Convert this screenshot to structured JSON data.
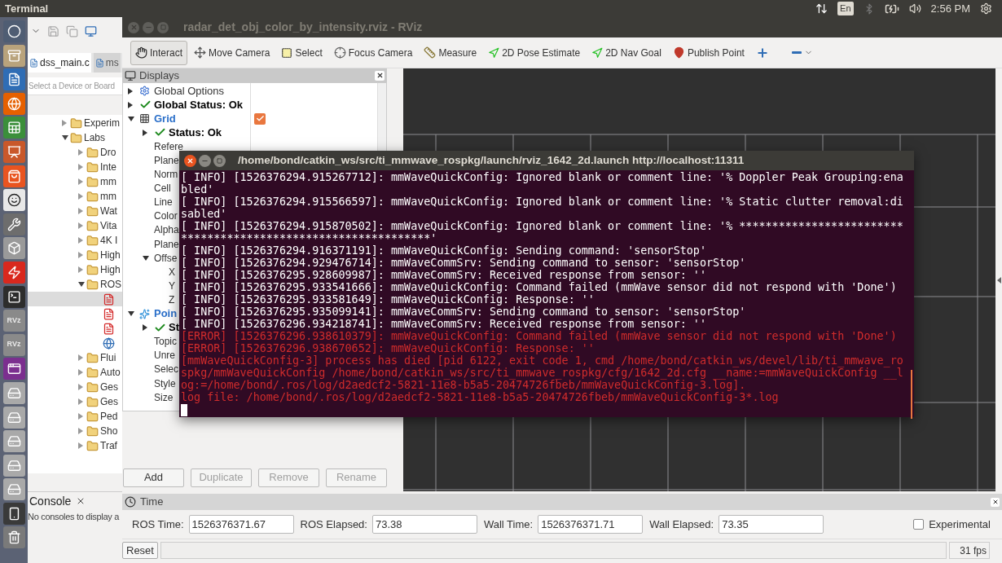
{
  "top_bar": {
    "title": "Terminal",
    "keyboard": "En",
    "clock": "2:56 PM"
  },
  "launcher": [
    {
      "kind": "home"
    },
    {
      "kind": "files"
    },
    {
      "kind": "writer"
    },
    {
      "kind": "browser"
    },
    {
      "kind": "calc"
    },
    {
      "kind": "impress"
    },
    {
      "kind": "store"
    },
    {
      "kind": "shop"
    },
    {
      "kind": "settings"
    },
    {
      "kind": "cube"
    },
    {
      "kind": "flash"
    },
    {
      "kind": "terminal"
    },
    {
      "kind": "text",
      "label": "RVz"
    },
    {
      "kind": "text",
      "label": "RVz"
    },
    {
      "kind": "window"
    },
    {
      "kind": "drive"
    },
    {
      "kind": "drive"
    },
    {
      "kind": "drive"
    },
    {
      "kind": "drive"
    },
    {
      "kind": "drive"
    },
    {
      "kind": "phone"
    },
    {
      "kind": "trash"
    }
  ],
  "ide": {
    "tabs": [
      {
        "label": "dss_main.c",
        "selected": true
      },
      {
        "label": "ms",
        "selected": false
      }
    ],
    "search": {
      "placeholder": "Select a Device or Board"
    },
    "tree": [
      {
        "label": "Experim",
        "kind": "folder",
        "expanded": false,
        "selected": false
      },
      {
        "label": "Labs",
        "kind": "folder",
        "expanded": true,
        "selected": false,
        "children": [
          {
            "label": "Dro",
            "kind": "folder",
            "expanded": false,
            "selected": false
          },
          {
            "label": "Inte",
            "kind": "folder",
            "expanded": false,
            "selected": false
          },
          {
            "label": "mm",
            "kind": "folder",
            "expanded": false,
            "selected": false
          },
          {
            "label": "mm",
            "kind": "folder",
            "expanded": false,
            "selected": false
          },
          {
            "label": "Wat",
            "kind": "folder",
            "expanded": false,
            "selected": false
          },
          {
            "label": "Vita",
            "kind": "folder",
            "expanded": false,
            "selected": false
          },
          {
            "label": "4K I",
            "kind": "folder",
            "expanded": false,
            "selected": false
          },
          {
            "label": "High",
            "kind": "folder",
            "expanded": false,
            "selected": false
          },
          {
            "label": "High",
            "kind": "folder",
            "expanded": false,
            "selected": false
          },
          {
            "label": "ROS",
            "kind": "folder",
            "expanded": true,
            "selected": false,
            "children": [
              {
                "kind": "pdf",
                "selected": true
              },
              {
                "kind": "pdf",
                "selected": false
              },
              {
                "kind": "pdf",
                "selected": false
              },
              {
                "kind": "web",
                "selected": false
              }
            ]
          },
          {
            "label": "Flui",
            "kind": "folder",
            "expanded": false,
            "selected": false
          },
          {
            "label": "Auto",
            "kind": "folder",
            "expanded": false,
            "selected": false
          },
          {
            "label": "Ges",
            "kind": "folder",
            "expanded": false,
            "selected": false
          },
          {
            "label": "Ges",
            "kind": "folder",
            "expanded": false,
            "selected": false
          },
          {
            "label": "Ped",
            "kind": "folder",
            "expanded": false,
            "selected": false
          },
          {
            "label": "Sho",
            "kind": "folder",
            "expanded": false,
            "selected": false
          },
          {
            "label": "Traf",
            "kind": "folder",
            "expanded": false,
            "selected": false
          }
        ]
      }
    ],
    "console": {
      "tab": "Console",
      "message": "No consoles to display a"
    }
  },
  "rviz": {
    "title": "radar_det_obj_color_by_intensity.rviz - RViz",
    "tools": [
      {
        "kind": "interact",
        "label": "Interact",
        "selected": true
      },
      {
        "kind": "move-camera",
        "label": "Move Camera",
        "selected": false
      },
      {
        "kind": "select",
        "label": "Select",
        "selected": false
      },
      {
        "kind": "focus-camera",
        "label": "Focus Camera",
        "selected": false
      },
      {
        "kind": "measure",
        "label": "Measure",
        "selected": false
      },
      {
        "kind": "pose",
        "label": "2D Pose Estimate",
        "selected": false
      },
      {
        "kind": "nav-goal",
        "label": "2D Nav Goal",
        "selected": false
      },
      {
        "kind": "publish-point",
        "label": "Publish Point",
        "selected": false
      },
      {
        "kind": "add",
        "selected": false
      },
      {
        "kind": "remove",
        "selected": false
      }
    ],
    "displays": {
      "title": "Displays",
      "tree": [
        {
          "kind": "options",
          "label": "Global Options",
          "expanded": false
        },
        {
          "kind": "status",
          "label": "Global Status: Ok",
          "expanded": false
        },
        {
          "kind": "grid",
          "label": "Grid",
          "expanded": true,
          "checked": true,
          "children": [
            {
              "kind": "status",
              "label": "Status: Ok",
              "expanded": false
            },
            {
              "kind": "property",
              "label": "Refere"
            },
            {
              "kind": "property",
              "label": "Plane"
            },
            {
              "kind": "property",
              "label": "Norm"
            },
            {
              "kind": "property",
              "label": "Cell"
            },
            {
              "kind": "property",
              "label": "Line"
            },
            {
              "kind": "property",
              "label": "Color"
            },
            {
              "kind": "property",
              "label": "Alpha"
            },
            {
              "kind": "property",
              "label": "Plane"
            },
            {
              "kind": "property",
              "label": "Offse",
              "expanded": true,
              "children": [
                {
                  "kind": "property",
                  "label": "X"
                },
                {
                  "kind": "property",
                  "label": "Y"
                },
                {
                  "kind": "property",
                  "label": "Z"
                }
              ]
            }
          ]
        },
        {
          "kind": "points",
          "label": "Poin",
          "expanded": true,
          "children": [
            {
              "kind": "status",
              "label": "St",
              "expanded": false
            },
            {
              "kind": "property",
              "label": "Topic"
            },
            {
              "kind": "property",
              "label": "Unre"
            },
            {
              "kind": "property",
              "label": "Selec"
            },
            {
              "kind": "property",
              "label": "Style"
            },
            {
              "kind": "property",
              "label": "Size"
            }
          ]
        }
      ],
      "buttons": [
        {
          "label": "Add",
          "disabled": false
        },
        {
          "label": "Duplicate",
          "disabled": true
        },
        {
          "label": "Remove",
          "disabled": true
        },
        {
          "label": "Rename",
          "disabled": true
        }
      ]
    },
    "time": {
      "title": "Time",
      "fields": [
        {
          "label": "ROS Time:",
          "value": "1526376371.67"
        },
        {
          "label": "ROS Elapsed:",
          "value": "73.38"
        },
        {
          "label": "Wall Time:",
          "value": "1526376371.71"
        },
        {
          "label": "Wall Elapsed:",
          "value": "73.35"
        }
      ],
      "experimental": {
        "label": "Experimental",
        "checked": false
      }
    },
    "status_bar": {
      "reset": "Reset",
      "fps": "31 fps"
    }
  },
  "terminal": {
    "title": "/home/bond/catkin_ws/src/ti_mmwave_rospkg/launch/rviz_1642_2d.launch http://localhost:11311",
    "lines": [
      {
        "kind": "info",
        "text": "[ INFO] [1526376294.915267712]: mmWaveQuickConfig: Ignored blank or comment line: '% Doppler Peak Grouping:ena"
      },
      {
        "kind": "info",
        "text": "bled'"
      },
      {
        "kind": "info",
        "text": "[ INFO] [1526376294.915566597]: mmWaveQuickConfig: Ignored blank or comment line: '% Static clutter removal:di"
      },
      {
        "kind": "info",
        "text": "sabled'"
      },
      {
        "kind": "info",
        "text": "[ INFO] [1526376294.915870502]: mmWaveQuickConfig: Ignored blank or comment line: '% *************************"
      },
      {
        "kind": "info",
        "text": "**************************************'"
      },
      {
        "kind": "info",
        "text": "[ INFO] [1526376294.916371191]: mmWaveQuickConfig: Sending command: 'sensorStop'"
      },
      {
        "kind": "info",
        "text": "[ INFO] [1526376294.929476714]: mmWaveCommSrv: Sending command to sensor: 'sensorStop'"
      },
      {
        "kind": "info",
        "text": "[ INFO] [1526376295.928609987]: mmWaveCommSrv: Received response from sensor: ''"
      },
      {
        "kind": "info",
        "text": "[ INFO] [1526376295.933541666]: mmWaveQuickConfig: Command failed (mmWave sensor did not respond with 'Done')"
      },
      {
        "kind": "info",
        "text": "[ INFO] [1526376295.933581649]: mmWaveQuickConfig: Response: ''"
      },
      {
        "kind": "info",
        "text": "[ INFO] [1526376295.935099141]: mmWaveCommSrv: Sending command to sensor: 'sensorStop'"
      },
      {
        "kind": "info",
        "text": "[ INFO] [1526376296.934218741]: mmWaveCommSrv: Received response from sensor: ''"
      },
      {
        "kind": "error",
        "text": "[ERROR] [1526376296.938610379]: mmWaveQuickConfig: Command failed (mmWave sensor did not respond with 'Done')"
      },
      {
        "kind": "error",
        "text": "[ERROR] [1526376296.938670652]: mmWaveQuickConfig: Response: ''"
      },
      {
        "kind": "error",
        "text": "[mmWaveQuickConfig-3] process has died [pid 6122, exit code 1, cmd /home/bond/catkin_ws/devel/lib/ti_mmwave_ro"
      },
      {
        "kind": "error",
        "text": "spkg/mmWaveQuickConfig /home/bond/catkin_ws/src/ti_mmwave_rospkg/cfg/1642_2d.cfg __name:=mmWaveQuickConfig __l"
      },
      {
        "kind": "error",
        "text": "og:=/home/bond/.ros/log/d2aedcf2-5821-11e8-b5a5-20474726fbeb/mmWaveQuickConfig-3.log]."
      },
      {
        "kind": "error",
        "text": "log file: /home/bond/.ros/log/d2aedcf2-5821-11e8-b5a5-20474726fbeb/mmWaveQuickConfig-3*.log"
      }
    ]
  }
}
